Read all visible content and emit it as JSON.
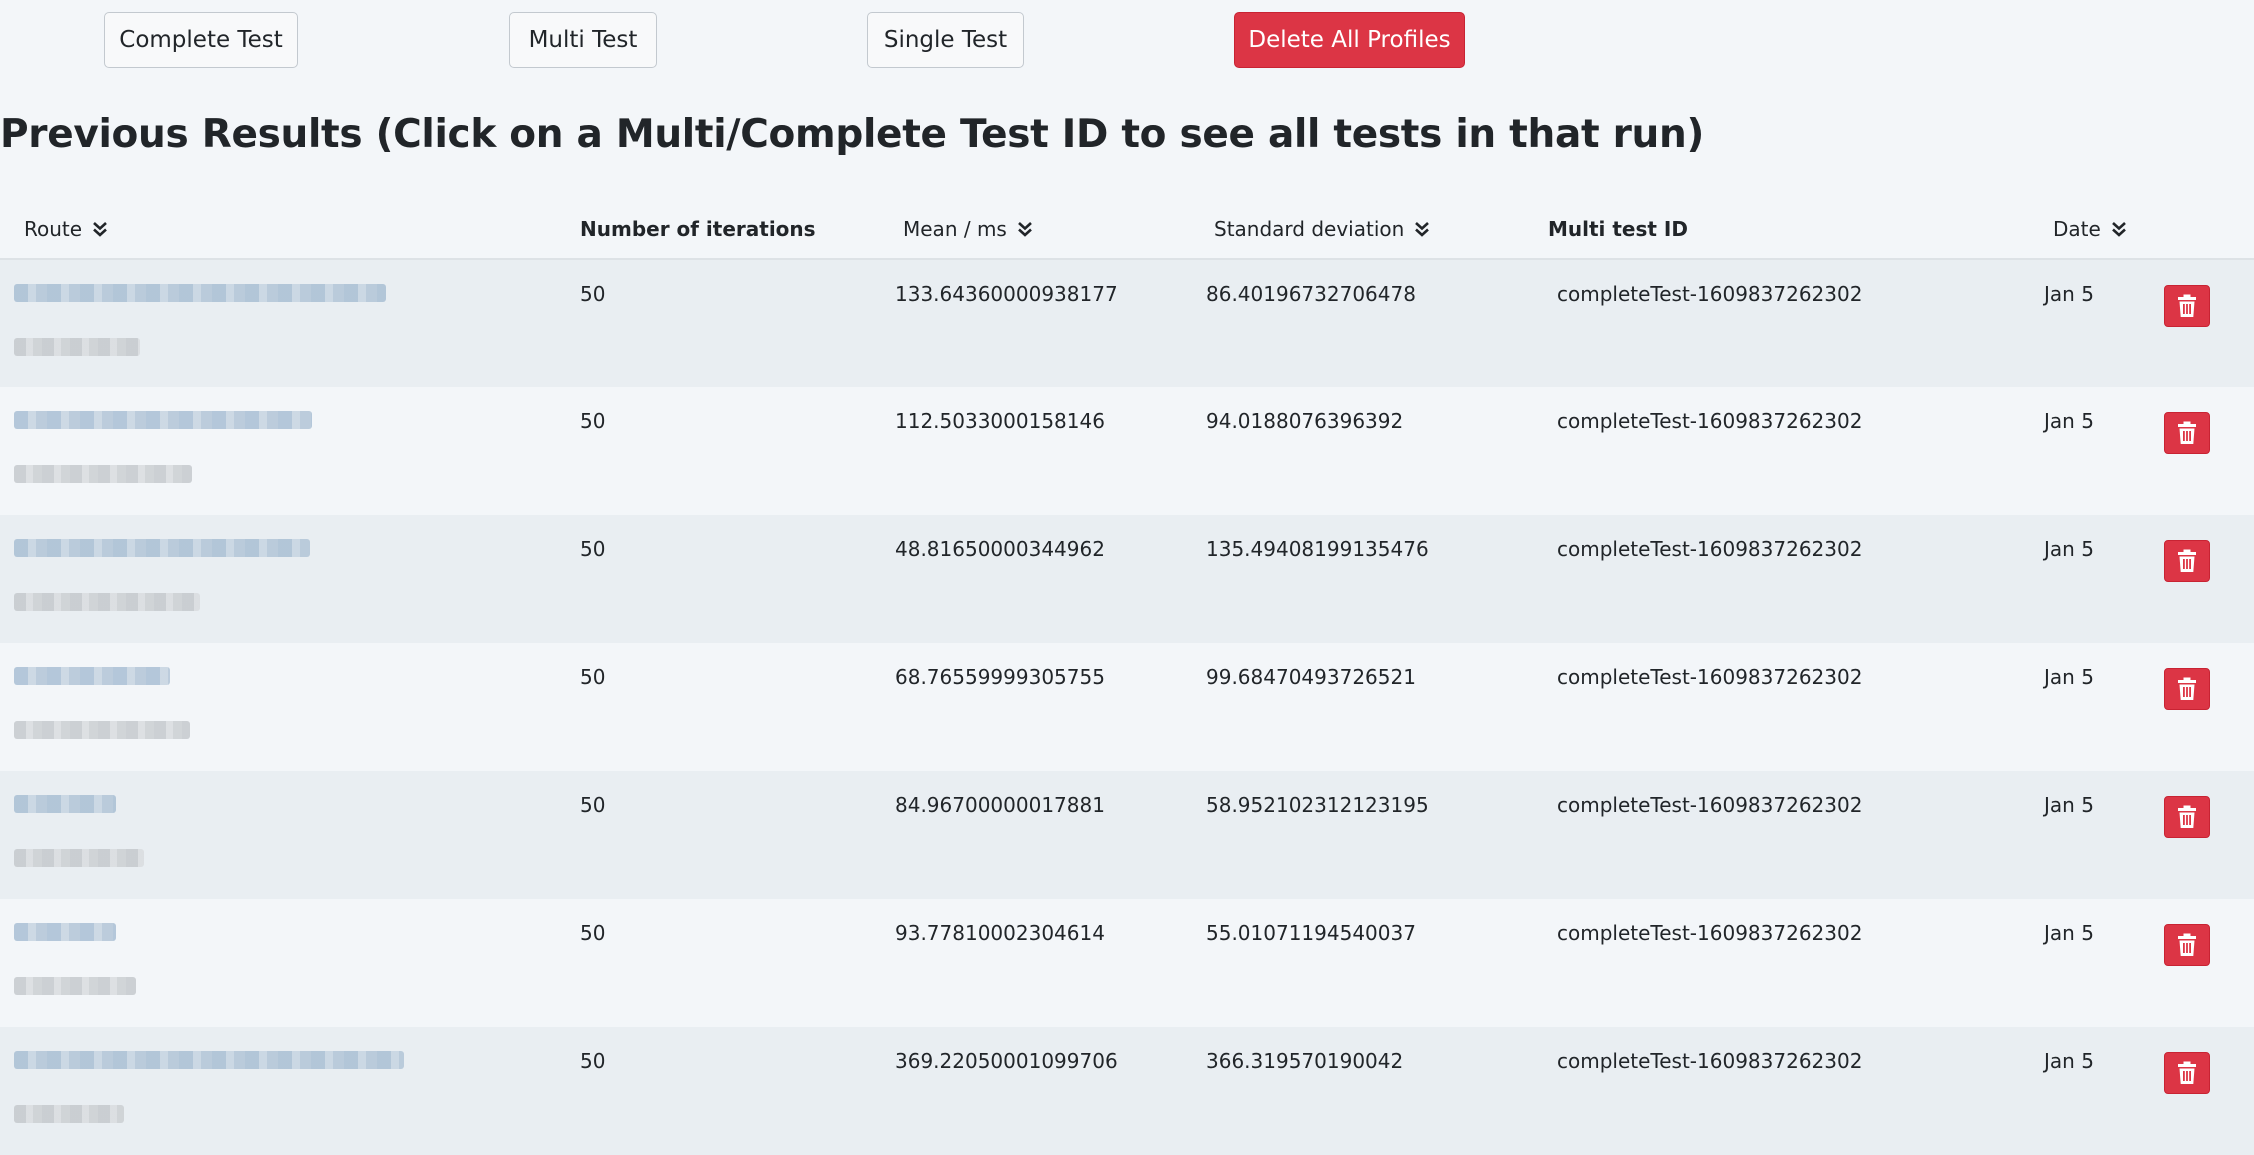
{
  "toolbar": {
    "complete_test_label": "Complete Test",
    "multi_test_label": "Multi Test",
    "single_test_label": "Single Test",
    "delete_all_label": "Delete All Profiles"
  },
  "heading": "Previous Results (Click on a Multi/Complete Test ID to see all tests in that run)",
  "table": {
    "columns": {
      "route": "Route",
      "iterations": "Number of iterations",
      "mean": "Mean / ms",
      "std": "Standard deviation",
      "multi_id": "Multi test ID",
      "date": "Date"
    },
    "rows": [
      {
        "iterations": "50",
        "mean": "133.64360000938177",
        "std": "86.40196732706478",
        "multi_id": "completeTest-1609837262302",
        "date": "Jan 5"
      },
      {
        "iterations": "50",
        "mean": "112.5033000158146",
        "std": "94.0188076396392",
        "multi_id": "completeTest-1609837262302",
        "date": "Jan 5"
      },
      {
        "iterations": "50",
        "mean": "48.81650000344962",
        "std": "135.49408199135476",
        "multi_id": "completeTest-1609837262302",
        "date": "Jan 5"
      },
      {
        "iterations": "50",
        "mean": "68.76559999305755",
        "std": "99.68470493726521",
        "multi_id": "completeTest-1609837262302",
        "date": "Jan 5"
      },
      {
        "iterations": "50",
        "mean": "84.96700000017881",
        "std": "58.952102312123195",
        "multi_id": "completeTest-1609837262302",
        "date": "Jan 5"
      },
      {
        "iterations": "50",
        "mean": "93.77810002304614",
        "std": "55.01071194540037",
        "multi_id": "completeTest-1609837262302",
        "date": "Jan 5"
      },
      {
        "iterations": "50",
        "mean": "369.22050001099706",
        "std": "366.319570190042",
        "multi_id": "completeTest-1609837262302",
        "date": "Jan 5"
      }
    ]
  },
  "icons": {
    "sort": "double-chevron-down-icon",
    "delete": "trash-icon"
  },
  "colors": {
    "danger": "#dc3545",
    "background": "#f3f6f9",
    "row_stripe": "#e9eef2"
  }
}
